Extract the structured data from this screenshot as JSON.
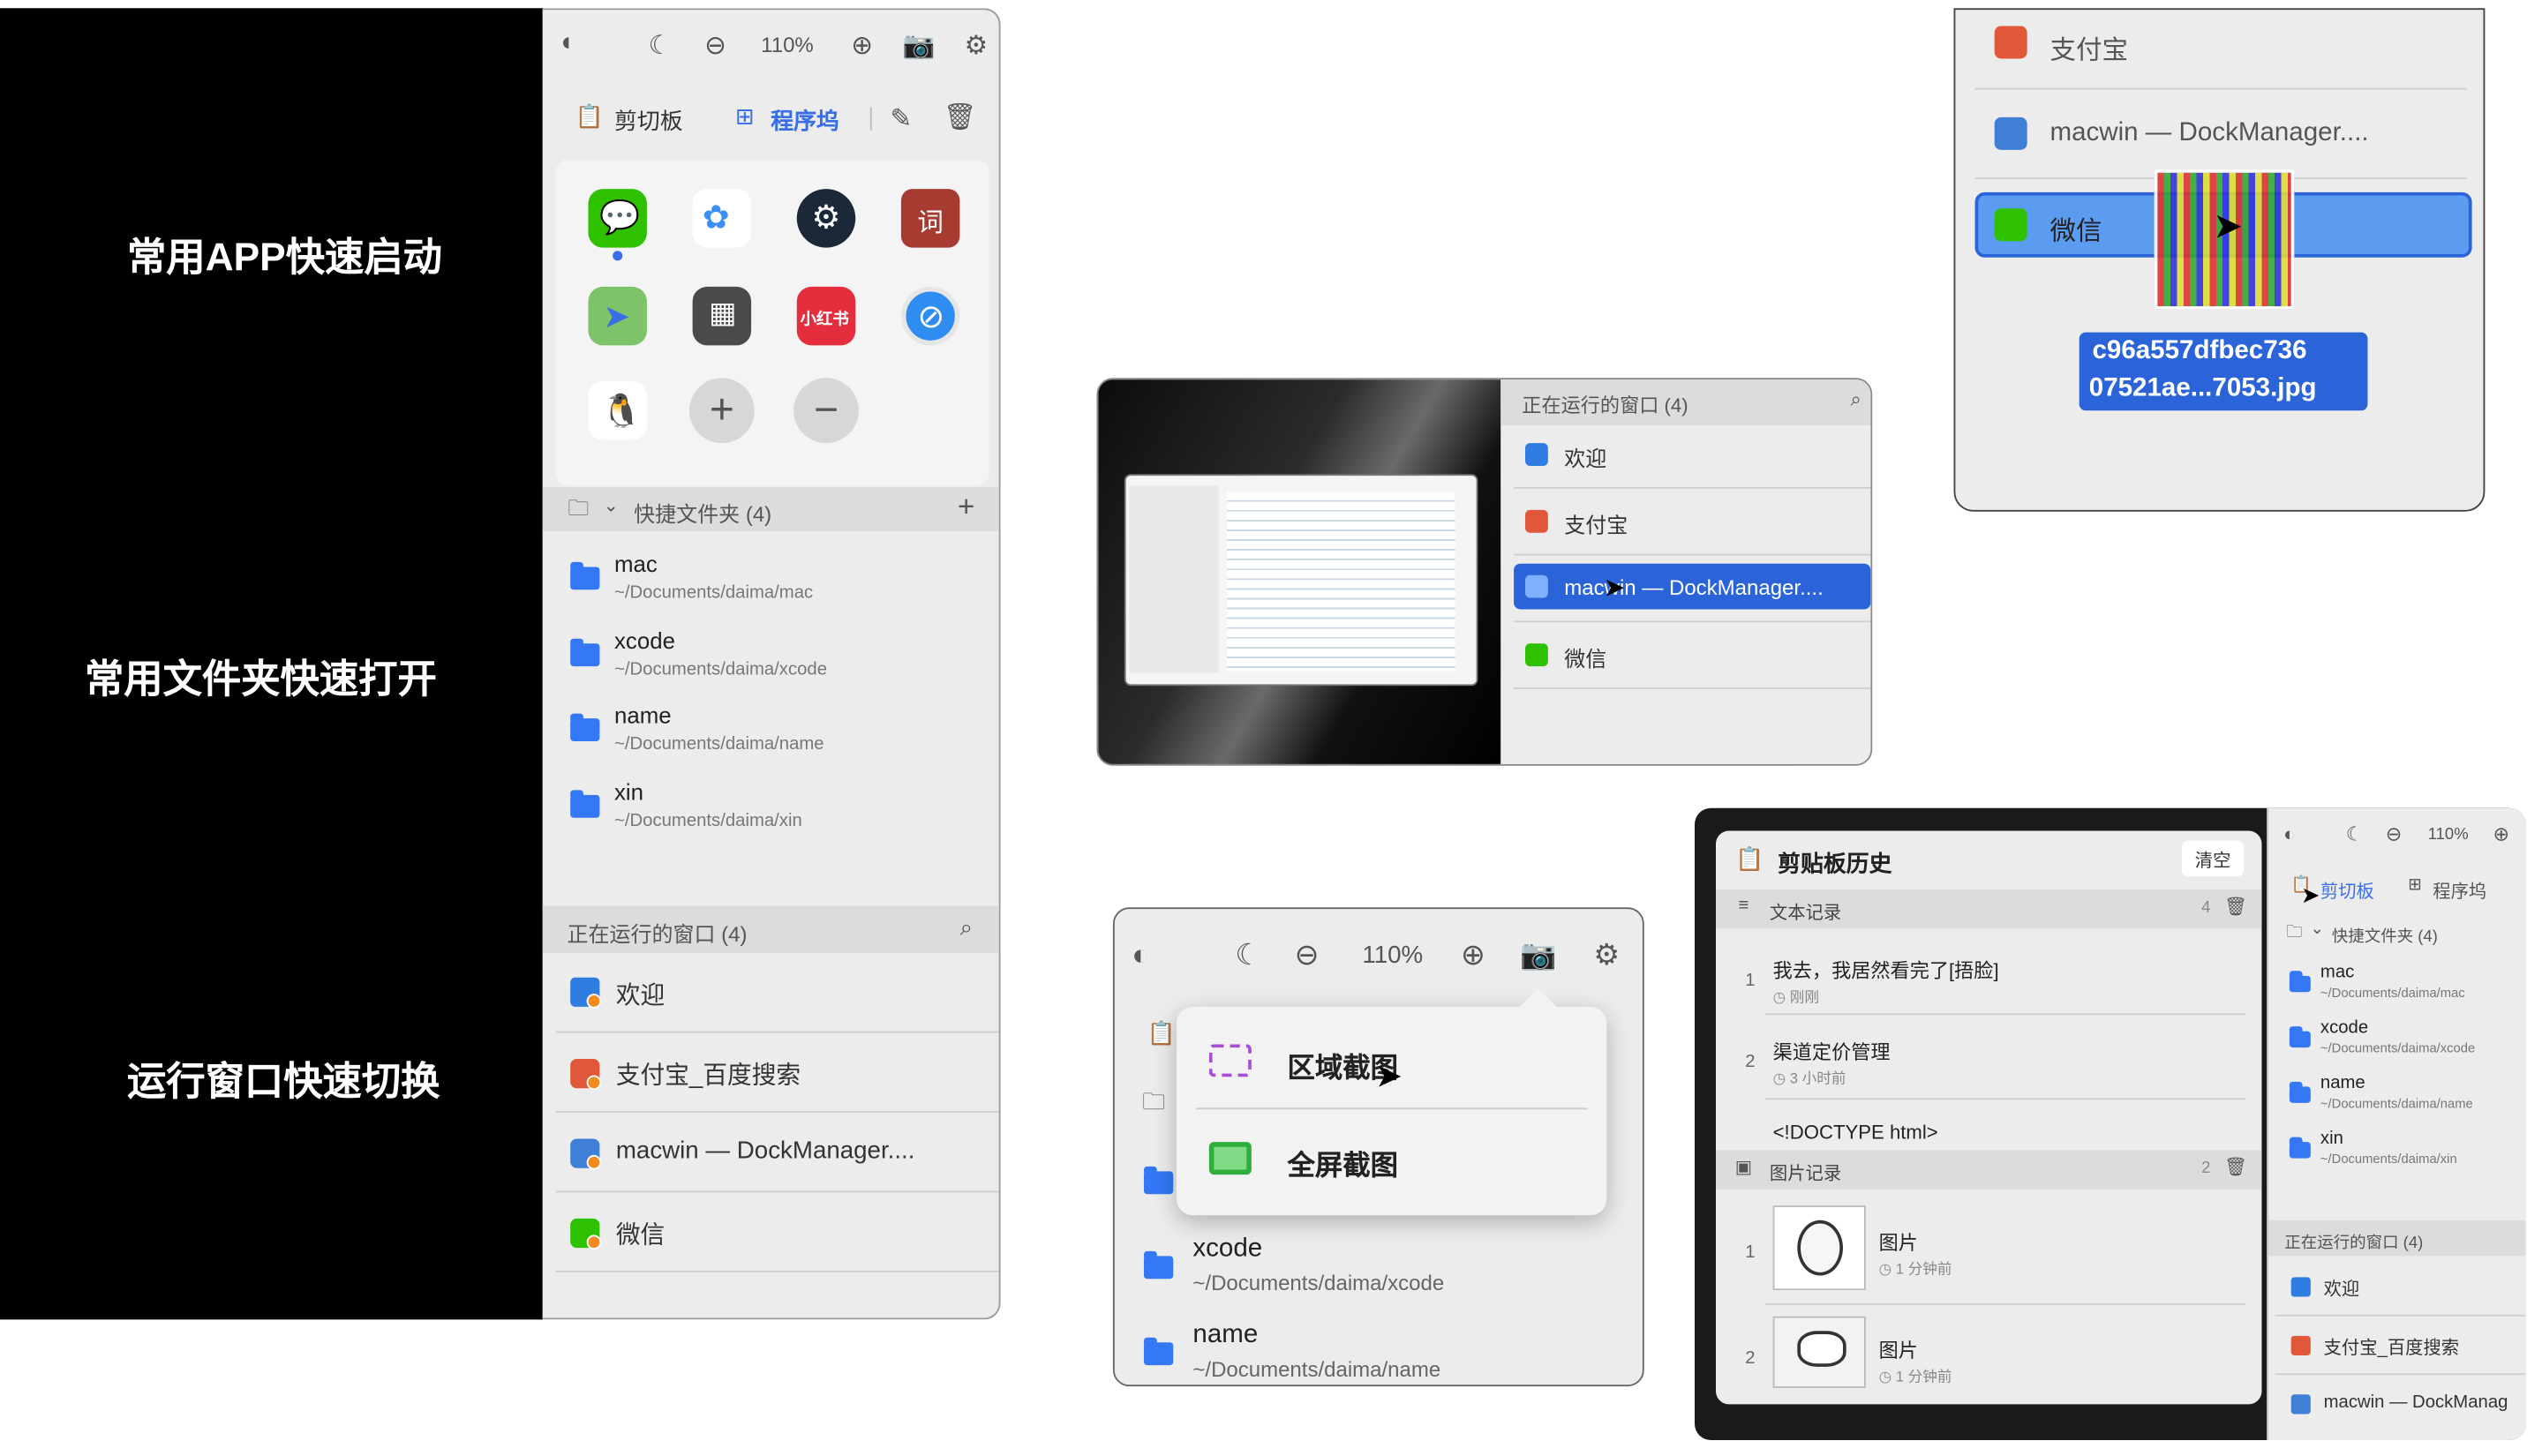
{
  "features": [
    "常用APP快速启动",
    "常用文件夹快速打开",
    "运行窗口快速切换"
  ],
  "main": {
    "zoom": "110%",
    "tabs": [
      "剪切板",
      "程序坞"
    ],
    "dict_glyph": "词",
    "xhs_glyph": "小红书",
    "folders_title": "快捷文件夹 (4)",
    "folders": [
      {
        "name": "mac",
        "path": "~/Documents/daima/mac"
      },
      {
        "name": "xcode",
        "path": "~/Documents/daima/xcode"
      },
      {
        "name": "name",
        "path": "~/Documents/daima/name"
      },
      {
        "name": "xin",
        "path": "~/Documents/daima/xin"
      }
    ],
    "running_title": "正在运行的窗口 (4)",
    "running": [
      "欢迎",
      "支付宝_百度搜索",
      "macwin — DockManager....",
      "微信"
    ]
  },
  "switcher": {
    "title": "正在运行的窗口 (4)",
    "items": [
      "欢迎",
      "支付宝",
      "macwin — DockManager....",
      "微信"
    ]
  },
  "drag": {
    "items": [
      "支付宝",
      "macwin — DockManager....",
      "微信"
    ],
    "file_line1": "c96a557dfbec736",
    "file_line2": "07521ae...7053.jpg"
  },
  "shot": {
    "zoom": "110%",
    "folders": [
      {
        "name": "xcode",
        "path": "~/Documents/daima/xcode"
      },
      {
        "name": "name",
        "path": "~/Documents/daima/name"
      }
    ],
    "menu": [
      "区域截图",
      "全屏截图"
    ]
  },
  "history": {
    "title": "剪贴板历史",
    "clear": "清空",
    "text_header": "文本记录",
    "text_count": "4",
    "texts": [
      {
        "idx": "1",
        "text": "我去，我居然看完了[捂脸]",
        "time": "◷ 刚刚"
      },
      {
        "idx": "2",
        "text": "渠道定价管理",
        "time": "◷ 3 小时前"
      },
      {
        "text": "<!DOCTYPE html>"
      }
    ],
    "image_header": "图片记录",
    "image_count": "2",
    "images": [
      {
        "idx": "1",
        "text": "图片",
        "time": "◷ 1 分钟前"
      },
      {
        "idx": "2",
        "text": "图片",
        "time": "◷ 1 分钟前"
      }
    ]
  },
  "mini": {
    "zoom": "110%",
    "tabs": [
      "剪切板",
      "程序坞"
    ],
    "folders_title": "快捷文件夹 (4)",
    "folders": [
      {
        "name": "mac",
        "path": "~/Documents/daima/mac"
      },
      {
        "name": "xcode",
        "path": "~/Documents/daima/xcode"
      },
      {
        "name": "name",
        "path": "~/Documents/daima/name"
      },
      {
        "name": "xin",
        "path": "~/Documents/daima/xin"
      }
    ],
    "running_title": "正在运行的窗口 (4)",
    "running": [
      "欢迎",
      "支付宝_百度搜索",
      "macwin — DockManag"
    ]
  }
}
